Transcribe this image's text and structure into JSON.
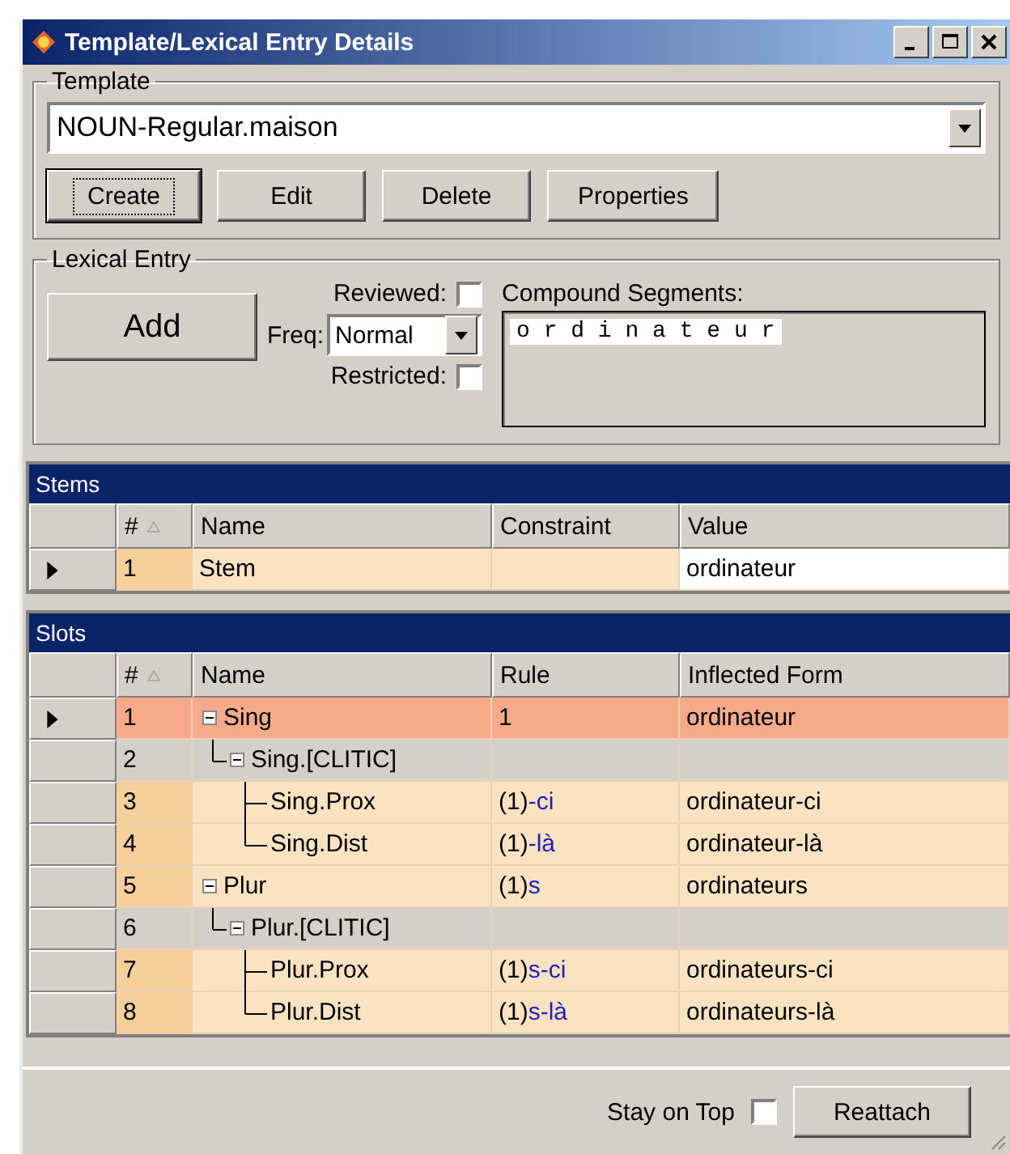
{
  "window": {
    "title": "Template/Lexical Entry Details"
  },
  "template": {
    "label": "Template",
    "value": "NOUN-Regular.maison",
    "buttons": [
      {
        "label": "Create",
        "focused": true
      },
      {
        "label": "Edit",
        "focused": false
      },
      {
        "label": "Delete",
        "focused": false
      },
      {
        "label": "Properties",
        "focused": false
      }
    ]
  },
  "lexical_entry": {
    "label": "Lexical Entry",
    "add_button": "Add",
    "reviewed": {
      "label": "Reviewed:",
      "checked": false
    },
    "freq": {
      "label": "Freq:",
      "value": "Normal"
    },
    "restricted": {
      "label": "Restricted:",
      "checked": false
    },
    "compound_segments": {
      "label": "Compound Segments:",
      "value": "o r d i n a t e u r"
    }
  },
  "stems": {
    "title": "Stems",
    "columns": [
      "#",
      "Name",
      "Constraint",
      "Value"
    ],
    "rows": [
      {
        "number": "1",
        "name": "Stem",
        "constraint": "",
        "value": "ordinateur",
        "selected": true
      }
    ]
  },
  "slots": {
    "title": "Slots",
    "columns": [
      "#",
      "Name",
      "Rule",
      "Inflected Form"
    ],
    "rows": [
      {
        "number": "1",
        "name": "Sing",
        "rule": {
          "base": "1"
        },
        "form": "ordinateur",
        "kind": "slot",
        "selected": true,
        "expanded": true,
        "children": [
          {
            "number": "2",
            "name": "Sing.[CLITIC]",
            "kind": "group",
            "selected": false,
            "expanded": true,
            "children": [
              {
                "number": "3",
                "name": "Sing.Prox",
                "rule": {
                  "base": "(1)",
                  "suffix": "-ci"
                },
                "form": "ordinateur-ci",
                "kind": "slot",
                "selected": false
              },
              {
                "number": "4",
                "name": "Sing.Dist",
                "rule": {
                  "base": "(1)",
                  "suffix": "-là"
                },
                "form": "ordinateur-là",
                "kind": "slot",
                "selected": false
              }
            ]
          }
        ]
      },
      {
        "number": "5",
        "name": "Plur",
        "rule": {
          "base": "(1)",
          "suffix": "s"
        },
        "form": "ordinateurs",
        "kind": "slot",
        "selected": false,
        "expanded": true,
        "children": [
          {
            "number": "6",
            "name": "Plur.[CLITIC]",
            "kind": "group",
            "selected": false,
            "expanded": true,
            "children": [
              {
                "number": "7",
                "name": "Plur.Prox",
                "rule": {
                  "base": "(1)",
                  "suffix": "s-ci"
                },
                "form": "ordinateurs-ci",
                "kind": "slot",
                "selected": false
              },
              {
                "number": "8",
                "name": "Plur.Dist",
                "rule": {
                  "base": "(1)",
                  "suffix": "s-là"
                },
                "form": "ordinateurs-là",
                "kind": "slot",
                "selected": false
              }
            ]
          }
        ]
      }
    ]
  },
  "footer": {
    "stay_on_top": {
      "label": "Stay on Top",
      "checked": false
    },
    "reattach_button": "Reattach"
  }
}
